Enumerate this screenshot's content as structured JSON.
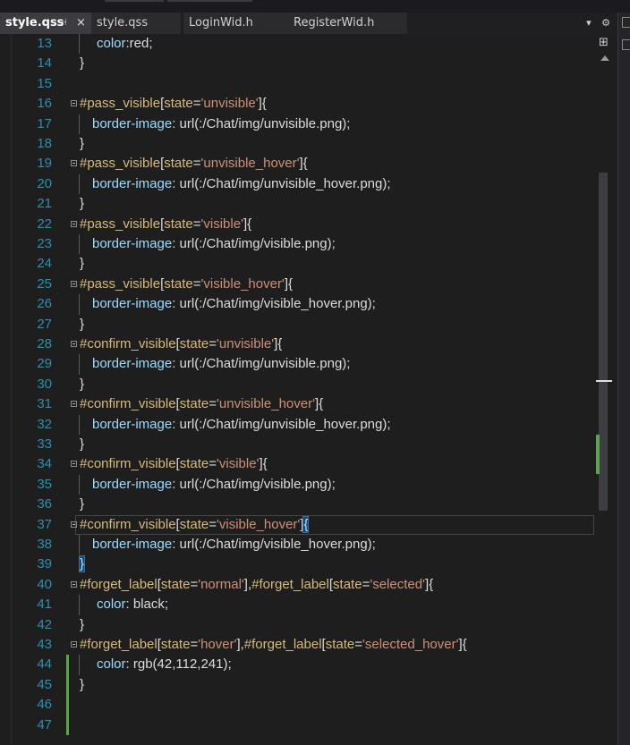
{
  "tabs": [
    {
      "label": "style.qss",
      "active": true,
      "pin_icon": "pin-icon",
      "close_icon": "close-icon",
      "close_label": "×",
      "pin_label": "⊣"
    },
    {
      "label": "style.qss",
      "active": false
    },
    {
      "label": "LoginWid.h",
      "active": false
    },
    {
      "label": "RegisterWid.h",
      "active": false
    }
  ],
  "tabbar_right": {
    "dropdown_icon": "chevron-down-icon",
    "dropdown_label": "▾",
    "settings_icon": "gear-icon",
    "settings_label": "⚙"
  },
  "scrollbar": {
    "split_icon": "split-icon",
    "split_label": "⊞"
  },
  "lines": [
    {
      "n": "13",
      "parts": [
        {
          "t": "color",
          "c": "prop"
        },
        {
          "t": ":red;",
          "c": "val"
        }
      ],
      "indent": 2
    },
    {
      "n": "14",
      "parts": [
        {
          "t": "}",
          "c": "punct"
        }
      ],
      "indent": 0
    },
    {
      "n": "15",
      "parts": [],
      "indent": 0
    },
    {
      "n": "16",
      "parts": [
        {
          "t": "#pass_visible",
          "c": "selector"
        },
        {
          "t": "[",
          "c": "punct"
        },
        {
          "t": "state",
          "c": "selector"
        },
        {
          "t": "=",
          "c": "punct"
        },
        {
          "t": "'unvisible'",
          "c": "str"
        },
        {
          "t": "]{",
          "c": "punct"
        }
      ],
      "indent": 0,
      "fold": true
    },
    {
      "n": "17",
      "parts": [
        {
          "t": "border-image",
          "c": "prop"
        },
        {
          "t": ": url(:/Chat/img/unvisible.png);",
          "c": "val"
        }
      ],
      "indent": 1
    },
    {
      "n": "18",
      "parts": [
        {
          "t": "}",
          "c": "punct"
        }
      ],
      "indent": 0
    },
    {
      "n": "19",
      "parts": [
        {
          "t": "#pass_visible",
          "c": "selector"
        },
        {
          "t": "[",
          "c": "punct"
        },
        {
          "t": "state",
          "c": "selector"
        },
        {
          "t": "=",
          "c": "punct"
        },
        {
          "t": "'unvisible_hover'",
          "c": "str"
        },
        {
          "t": "]{",
          "c": "punct"
        }
      ],
      "indent": 0,
      "fold": true
    },
    {
      "n": "20",
      "parts": [
        {
          "t": "border-image",
          "c": "prop"
        },
        {
          "t": ": url(:/Chat/img/unvisible_hover.png);",
          "c": "val"
        }
      ],
      "indent": 1
    },
    {
      "n": "21",
      "parts": [
        {
          "t": "}",
          "c": "punct"
        }
      ],
      "indent": 0
    },
    {
      "n": "22",
      "parts": [
        {
          "t": "#pass_visible",
          "c": "selector"
        },
        {
          "t": "[",
          "c": "punct"
        },
        {
          "t": "state",
          "c": "selector"
        },
        {
          "t": "=",
          "c": "punct"
        },
        {
          "t": "'visible'",
          "c": "str"
        },
        {
          "t": "]{",
          "c": "punct"
        }
      ],
      "indent": 0,
      "fold": true
    },
    {
      "n": "23",
      "parts": [
        {
          "t": "border-image",
          "c": "prop"
        },
        {
          "t": ": url(:/Chat/img/visible.png);",
          "c": "val"
        }
      ],
      "indent": 1
    },
    {
      "n": "24",
      "parts": [
        {
          "t": "}",
          "c": "punct"
        }
      ],
      "indent": 0
    },
    {
      "n": "25",
      "parts": [
        {
          "t": "#pass_visible",
          "c": "selector"
        },
        {
          "t": "[",
          "c": "punct"
        },
        {
          "t": "state",
          "c": "selector"
        },
        {
          "t": "=",
          "c": "punct"
        },
        {
          "t": "'visible_hover'",
          "c": "str"
        },
        {
          "t": "]{",
          "c": "punct"
        }
      ],
      "indent": 0,
      "fold": true
    },
    {
      "n": "26",
      "parts": [
        {
          "t": "border-image",
          "c": "prop"
        },
        {
          "t": ": url(:/Chat/img/visible_hover.png);",
          "c": "val"
        }
      ],
      "indent": 1
    },
    {
      "n": "27",
      "parts": [
        {
          "t": "}",
          "c": "punct"
        }
      ],
      "indent": 0
    },
    {
      "n": "28",
      "parts": [
        {
          "t": "#confirm_visible",
          "c": "selector"
        },
        {
          "t": "[",
          "c": "punct"
        },
        {
          "t": "state",
          "c": "selector"
        },
        {
          "t": "=",
          "c": "punct"
        },
        {
          "t": "'unvisible'",
          "c": "str"
        },
        {
          "t": "]{",
          "c": "punct"
        }
      ],
      "indent": 0,
      "fold": true
    },
    {
      "n": "29",
      "parts": [
        {
          "t": "border-image",
          "c": "prop"
        },
        {
          "t": ": url(:/Chat/img/unvisible.png);",
          "c": "val"
        }
      ],
      "indent": 1
    },
    {
      "n": "30",
      "parts": [
        {
          "t": "}",
          "c": "punct"
        }
      ],
      "indent": 0
    },
    {
      "n": "31",
      "parts": [
        {
          "t": "#confirm_visible",
          "c": "selector"
        },
        {
          "t": "[",
          "c": "punct"
        },
        {
          "t": "state",
          "c": "selector"
        },
        {
          "t": "=",
          "c": "punct"
        },
        {
          "t": "'unvisible_hover'",
          "c": "str"
        },
        {
          "t": "]{",
          "c": "punct"
        }
      ],
      "indent": 0,
      "fold": true
    },
    {
      "n": "32",
      "parts": [
        {
          "t": "border-image",
          "c": "prop"
        },
        {
          "t": ": url(:/Chat/img/unvisible_hover.png);",
          "c": "val"
        }
      ],
      "indent": 1
    },
    {
      "n": "33",
      "parts": [
        {
          "t": "}",
          "c": "punct"
        }
      ],
      "indent": 0
    },
    {
      "n": "34",
      "parts": [
        {
          "t": "#confirm_visible",
          "c": "selector"
        },
        {
          "t": "[",
          "c": "punct"
        },
        {
          "t": "state",
          "c": "selector"
        },
        {
          "t": "=",
          "c": "punct"
        },
        {
          "t": "'visible'",
          "c": "str"
        },
        {
          "t": "]{",
          "c": "punct"
        }
      ],
      "indent": 0,
      "fold": true
    },
    {
      "n": "35",
      "parts": [
        {
          "t": "border-image",
          "c": "prop"
        },
        {
          "t": ": url(:/Chat/img/visible.png);",
          "c": "val"
        }
      ],
      "indent": 1
    },
    {
      "n": "36",
      "parts": [
        {
          "t": "}",
          "c": "punct"
        }
      ],
      "indent": 0
    },
    {
      "n": "37",
      "parts": [
        {
          "t": "#confirm_visible",
          "c": "selector"
        },
        {
          "t": "[",
          "c": "punct"
        },
        {
          "t": "state",
          "c": "selector"
        },
        {
          "t": "=",
          "c": "punct"
        },
        {
          "t": "'visible_hover'",
          "c": "str"
        },
        {
          "t": "]",
          "c": "punct"
        },
        {
          "t": "{",
          "c": "punct",
          "hl": true
        }
      ],
      "indent": 0,
      "fold": true,
      "current": true
    },
    {
      "n": "38",
      "parts": [
        {
          "t": "border-image",
          "c": "prop"
        },
        {
          "t": ": url(:/Chat/img/visible_hover.png);",
          "c": "val"
        }
      ],
      "indent": 1
    },
    {
      "n": "39",
      "parts": [
        {
          "t": "}",
          "c": "punct",
          "hl": true
        }
      ],
      "indent": 0
    },
    {
      "n": "40",
      "parts": [
        {
          "t": "#forget_label",
          "c": "selector"
        },
        {
          "t": "[",
          "c": "punct"
        },
        {
          "t": "state",
          "c": "selector"
        },
        {
          "t": "=",
          "c": "punct"
        },
        {
          "t": "'normal'",
          "c": "str"
        },
        {
          "t": "],",
          "c": "punct"
        },
        {
          "t": "#forget_label",
          "c": "selector"
        },
        {
          "t": "[",
          "c": "punct"
        },
        {
          "t": "state",
          "c": "selector"
        },
        {
          "t": "=",
          "c": "punct"
        },
        {
          "t": "'selected'",
          "c": "str"
        },
        {
          "t": "]{",
          "c": "punct"
        }
      ],
      "indent": 0,
      "fold": true
    },
    {
      "n": "41",
      "parts": [
        {
          "t": "color",
          "c": "prop"
        },
        {
          "t": ": black;",
          "c": "val"
        }
      ],
      "indent": 2
    },
    {
      "n": "42",
      "parts": [
        {
          "t": "}",
          "c": "punct"
        }
      ],
      "indent": 0
    },
    {
      "n": "43",
      "parts": [
        {
          "t": "#forget_label",
          "c": "selector"
        },
        {
          "t": "[",
          "c": "punct"
        },
        {
          "t": "state",
          "c": "selector"
        },
        {
          "t": "=",
          "c": "punct"
        },
        {
          "t": "'hover'",
          "c": "str"
        },
        {
          "t": "],",
          "c": "punct"
        },
        {
          "t": "#forget_label",
          "c": "selector"
        },
        {
          "t": "[",
          "c": "punct"
        },
        {
          "t": "state",
          "c": "selector"
        },
        {
          "t": "=",
          "c": "punct"
        },
        {
          "t": "'selected_hover'",
          "c": "str"
        },
        {
          "t": "]{",
          "c": "punct"
        }
      ],
      "indent": 0,
      "fold": true
    },
    {
      "n": "44",
      "parts": [
        {
          "t": "color",
          "c": "prop"
        },
        {
          "t": ": rgb(42,112,241);",
          "c": "val"
        }
      ],
      "indent": 2,
      "changed": true
    },
    {
      "n": "45",
      "parts": [
        {
          "t": "}",
          "c": "punct"
        }
      ],
      "indent": 0,
      "changed": true
    },
    {
      "n": "46",
      "parts": [],
      "indent": 0,
      "changed": true
    },
    {
      "n": "47",
      "parts": [],
      "indent": 0,
      "changed": true
    }
  ],
  "colors": {
    "background": "#1e1e1e",
    "line_number": "#2b91af",
    "selector": "#d7ba7d",
    "property": "#9cdcfe",
    "string": "#ce9178",
    "change_bar": "#57a64a"
  }
}
